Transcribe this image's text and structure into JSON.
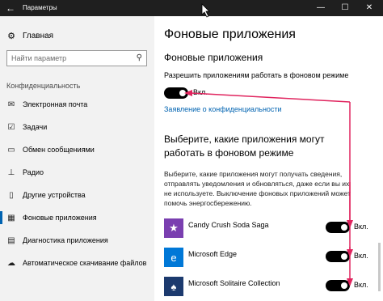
{
  "window": {
    "title": "Параметры",
    "back_icon": "←",
    "minimize": "—",
    "maximize": "☐",
    "close": "✕"
  },
  "sidebar": {
    "home": {
      "label": "Главная",
      "icon": "gear-icon"
    },
    "search": {
      "placeholder": "Найти параметр",
      "icon": "search-icon"
    },
    "section_header": "Конфиденциальность",
    "items": [
      {
        "label": "Электронная почта",
        "icon": "mail-icon"
      },
      {
        "label": "Задачи",
        "icon": "tasks-icon"
      },
      {
        "label": "Обмен сообщениями",
        "icon": "message-icon"
      },
      {
        "label": "Радио",
        "icon": "radio-icon"
      },
      {
        "label": "Другие устройства",
        "icon": "devices-icon"
      },
      {
        "label": "Фоновые приложения",
        "icon": "background-apps-icon",
        "active": true
      },
      {
        "label": "Диагностика приложения",
        "icon": "diagnostics-icon"
      },
      {
        "label": "Автоматическое скачивание файлов",
        "icon": "download-icon"
      }
    ]
  },
  "main": {
    "page_title": "Фоновые приложения",
    "section_title": "Фоновые приложения",
    "toggle_description": "Разрешить приложениям работать в фоновом режиме",
    "toggle_state": "Вкл.",
    "privacy_link": "Заявление о конфиденциальности",
    "choose_title": "Выберите, какие приложения могут работать в фоновом режиме",
    "description": "Выберите, какие приложения могут получать сведения, отправлять уведомления и обновляться, даже если вы их не используете. Выключение фоновых приложений может помочь энергосбережению.",
    "apps": [
      {
        "name": "Candy Crush Soda Saga",
        "state": "Вкл.",
        "icon": "candy-crush-icon",
        "color": "#7a3fb0"
      },
      {
        "name": "Microsoft Edge",
        "state": "Вкл.",
        "icon": "edge-icon",
        "color": "#0078d7"
      },
      {
        "name": "Microsoft Solitaire Collection",
        "state": "Вкл.",
        "icon": "solitaire-icon",
        "color": "#1c3a6e"
      }
    ]
  },
  "colors": {
    "accent": "#0063b1",
    "annotation": "#e0245e",
    "titlebar": "#1f1f1f",
    "sidebar": "#f2f2f2"
  }
}
